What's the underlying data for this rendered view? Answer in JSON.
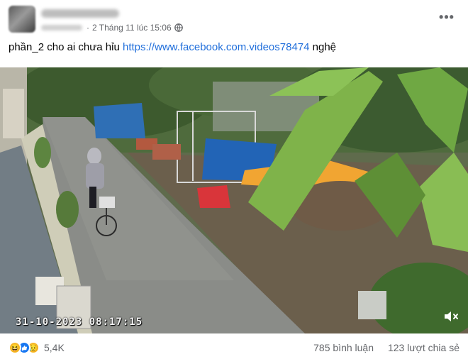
{
  "post": {
    "timestamp": "2 Tháng 11 lúc 15:06",
    "audience_icon": "globe-icon",
    "more_label": "•••",
    "text_before_link": "phần_2 cho ai chưa hỉu ",
    "link_text": "https://www.facebook.com.videos78474",
    "text_after_link": " nghệ"
  },
  "video": {
    "overlay_timestamp": "31-10-2023 08:17:15",
    "mute_icon": "speaker-muted-icon"
  },
  "footer": {
    "reaction_icons": [
      "haha-reaction-icon",
      "like-reaction-icon",
      "sad-reaction-icon"
    ],
    "reaction_count": "5,4K",
    "comments": "785 bình luận",
    "shares": "123 lượt chia sẻ"
  },
  "colors": {
    "link": "#216fdb",
    "meta_text": "#65676b",
    "like_blue": "#1877f2",
    "emoji_yellow": "#f7b928"
  }
}
